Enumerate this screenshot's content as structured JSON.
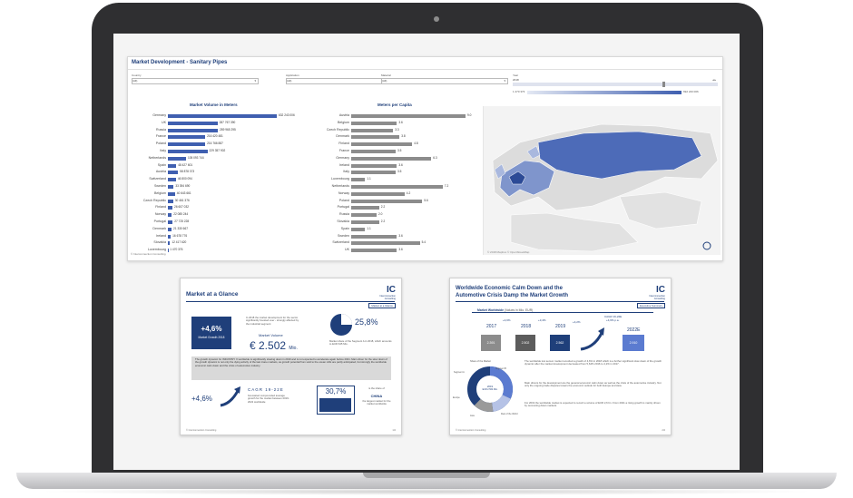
{
  "colors": {
    "brand": "#1f3f7a",
    "bar_blue": "#3f5fb0",
    "bar_gray": "#8c8c8c"
  },
  "dashboard": {
    "title": "Market Development - Sanitary Pipes",
    "filters": [
      {
        "label": "Country",
        "value": "(All)"
      },
      {
        "label": "Application",
        "value": "(All)"
      },
      {
        "label": "Material",
        "value": "(All)"
      },
      {
        "label": "Year",
        "value": "2018"
      }
    ],
    "legend_min": "1 470 373",
    "legend_max": "692 243 006",
    "copyright": "© Interconnection Consulting",
    "map_copyright": "© 2018 Mapbox © OpenStreetMap"
  },
  "chart_data": [
    {
      "type": "bar",
      "title": "Market Volume in Meters",
      "categories": [
        "Germany",
        "UK",
        "Russia",
        "France",
        "Poland",
        "Italy",
        "Netherlands",
        "Spain",
        "Austria",
        "Switzerland",
        "Sweden",
        "Belgium",
        "Czech Republic",
        "Finland",
        "Norway",
        "Portugal",
        "Denmark",
        "Ireland",
        "Slovakia",
        "Luxembourg"
      ],
      "value_labels": [
        "632 243 006",
        "287 767 390",
        "289 965 295",
        "216 420 481",
        "216 766 887",
        "229 357 902",
        "105 093 744",
        "48 427 601",
        "58 878 373",
        "46 800 094",
        "33 394 690",
        "40 643 661",
        "30 461 376",
        "26 607 032",
        "22 085 244",
        "27 725 228",
        "21 330 667",
        "16 678 776",
        "12 417 620",
        "1 470 376"
      ],
      "values": [
        632243006,
        287767390,
        289965295,
        216420481,
        216766887,
        229357902,
        105093744,
        48427601,
        58878373,
        46800094,
        33394690,
        40643661,
        30461376,
        26607032,
        22085244,
        27725228,
        21330667,
        16678776,
        12417620,
        1470376
      ]
    },
    {
      "type": "bar",
      "title": "Meters per Capita",
      "categories": [
        "Austria",
        "Belgium",
        "Czech Republic",
        "Denmark",
        "Finland",
        "France",
        "Germany",
        "Ireland",
        "Italy",
        "Luxembourg",
        "Netherlands",
        "Norway",
        "Poland",
        "Portugal",
        "Russia",
        "Slovakia",
        "Spain",
        "Sweden",
        "Switzerland",
        "UK"
      ],
      "value_labels": [
        "9.0",
        "3.6",
        "3.3",
        "3.8",
        "4.8",
        "3.5",
        "6.3",
        "3.6",
        "3.5",
        "1.1",
        "7.2",
        "4.2",
        "5.6",
        "2.2",
        "2.0",
        "2.2",
        "1.1",
        "3.6",
        "5.4",
        "3.6"
      ],
      "values": [
        9.0,
        3.6,
        3.3,
        3.8,
        4.8,
        3.5,
        6.3,
        3.6,
        3.5,
        1.1,
        7.2,
        4.2,
        5.6,
        2.2,
        2.0,
        2.2,
        1.1,
        3.6,
        5.4,
        3.6
      ]
    }
  ],
  "slide1": {
    "title": "Market at a Glance",
    "logo": "IC",
    "logo_sub": "Interconnection Consulting",
    "tag": "Market at a Glance",
    "growth_value": "+4,6%",
    "growth_label": "Market Growth 2018",
    "intro_text": "In 2018 the market development for the sector significantly boosted ever - strongly affected by the industrial segment",
    "volume_label": "Market Volume",
    "volume_value": "€ 2.502",
    "volume_unit": "Mio.",
    "pie_value": "25,8%",
    "pie_note": "Market share of the Segment A in 2018, which amounts to EUR 645 Mio.",
    "paragraph": "The growth dynamic for INDUSTRY X worldwide is significantly slowing down in 2019 and is not expected to accelerate again before 2021. Main driver for the slow down of the growth dynamic is not only the dying activity of the last crane markets, as growth potential from sold to the ocean mills are partly anticipated, but strongly the worldwide economic calm down and the crisis of automotive industry.",
    "cagr_value": "+4,6%",
    "cagr_title": "CAGR 19-22E",
    "cagr_text": "forecasted compounded average growth for the market between 2019-2022 worldwide",
    "share_value": "30,7%",
    "share_text_1": "is the share of",
    "share_country": "CHINA",
    "share_text_2": "the largest market for the market worldwide",
    "footer_left": "© Interconnection Consulting",
    "footer_right": "1/4"
  },
  "slide2": {
    "title_line1": "Worldwide Economic Calm Down and the",
    "title_line2": "Automotive Crisis Damp the Market Growth",
    "logo": "IC",
    "logo_sub": "Interconnection Consulting",
    "tag": "Executive Summary",
    "chart_label": "Market Worldwide",
    "chart_label_note": "(Values in Mio. EUR)",
    "years": [
      "2017",
      "2018",
      "2019",
      "2022E"
    ],
    "growth_steps": [
      "+4,6%",
      "+3,4%",
      "+4,2%"
    ],
    "cagr_label": "CAGR 19-22E",
    "cagr_value": "+4,6% p.a.",
    "values": [
      "2.391",
      "2.502",
      "2.562",
      "2.910"
    ],
    "donut_title": "Share of the Market",
    "donut_center": "2019",
    "donut_center_value": "EUR 2.562 Mio.",
    "donut_labels": [
      "Segment A",
      "Segment B",
      "Europe",
      "Rest of the World",
      "Asia"
    ],
    "text_1": "The worldwide low sensor market recorded a growth of 4,6% in 2018 which is a further significant slow down of the growth dynamic after the market development decreased from 5,64% 2016 to 4,2% in 2017.",
    "text_2": "Main drivers for the development are the general economic calm down as well as the crisis of the automotive industry. Not only the ongoing trade disputes lowers the economic outlook for both Europe and Asia.",
    "text_3": "For 2019 the worldwide market is expected to record a volume of EUR 2,6 bn. From 2021 a rising growth is mainly driven by recovering Asian markets.",
    "footer_left": "© Interconnection Consulting",
    "footer_right": "2/4"
  }
}
